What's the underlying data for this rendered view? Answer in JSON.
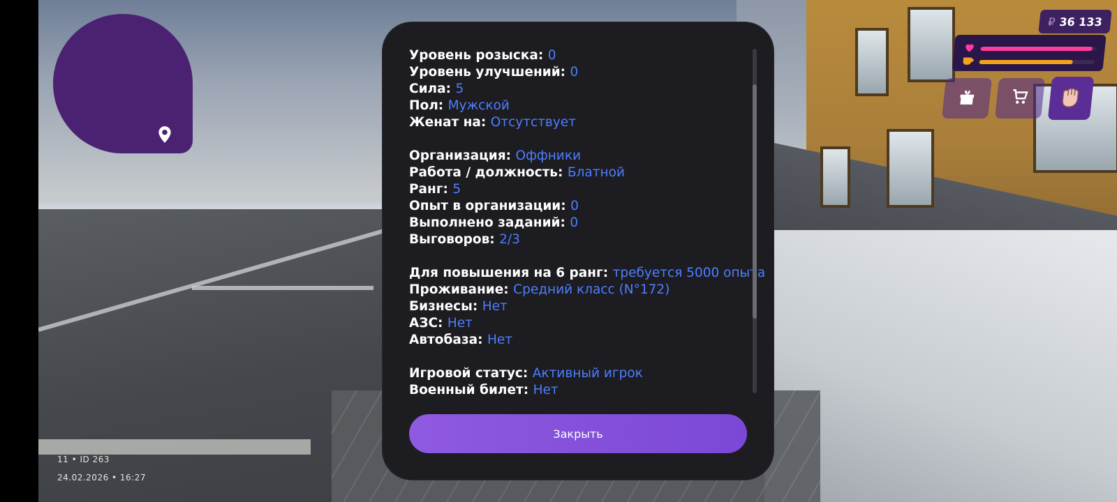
{
  "hud": {
    "money_symbol": "₽",
    "money": "36 133",
    "health_level": 0.97,
    "hunger_level": 0.81,
    "buttons": [
      "gift-icon",
      "cart-icon",
      "fist-icon"
    ]
  },
  "footer": {
    "id_line": "11 • ID 263",
    "datetime": "24.02.2026 • 16:27"
  },
  "stats": {
    "groups": [
      [
        {
          "label": "Уровень розыска:",
          "value": "0"
        },
        {
          "label": "Уровень улучшений:",
          "value": "0"
        },
        {
          "label": "Сила:",
          "value": "5"
        },
        {
          "label": "Пол:",
          "value": "Мужской"
        },
        {
          "label": "Женат на:",
          "value": "Отсутствует"
        }
      ],
      [
        {
          "label": "Организация:",
          "value": "Оффники"
        },
        {
          "label": "Работа / должность:",
          "value": "Блатной"
        },
        {
          "label": "Ранг:",
          "value": "5"
        },
        {
          "label": "Опыт в организации:",
          "value": "0"
        },
        {
          "label": "Выполнено заданий:",
          "value": "0"
        },
        {
          "label": "Выговоров:",
          "value": "2/3"
        }
      ],
      [
        {
          "label": "Для повышения на 6 ранг:",
          "value": "требуется 5000 опыта"
        },
        {
          "label": "Проживание:",
          "value": "Средний класс (N°172)"
        },
        {
          "label": "Бизнесы:",
          "value": "Нет"
        },
        {
          "label": "АЗС:",
          "value": "Нет"
        },
        {
          "label": "Автобаза:",
          "value": "Нет"
        }
      ],
      [
        {
          "label": "Игровой статус:",
          "value": "Активный игрок"
        },
        {
          "label": "Военный билет:",
          "value": "Нет"
        }
      ]
    ],
    "scroll_position": 0.32
  },
  "close_label": "Закрыть",
  "colors": {
    "value": "#4d7fff",
    "button": "#8a55dd",
    "panel": "#1c1c21",
    "health": "#ff3d9a",
    "hunger": "#f5a21b",
    "minimap": "#4b2272"
  }
}
